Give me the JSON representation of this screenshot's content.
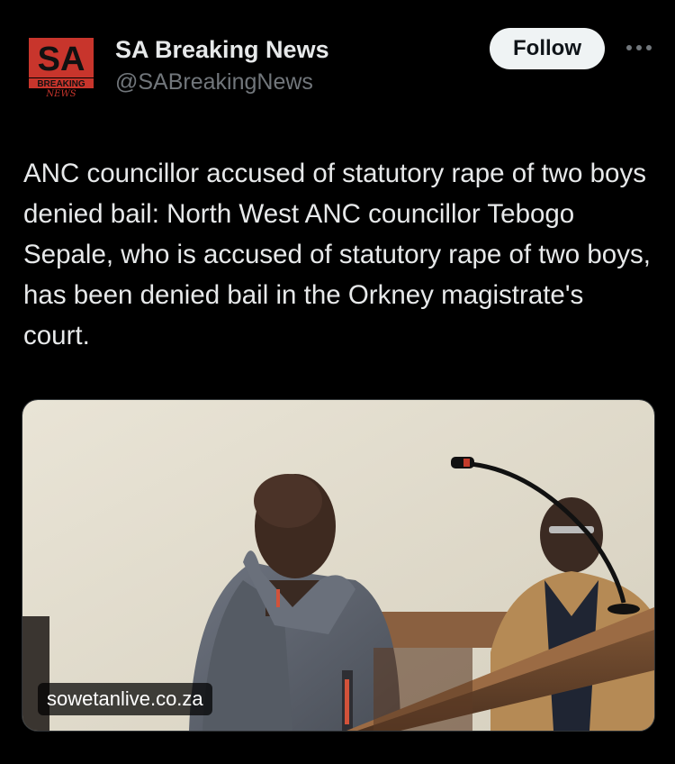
{
  "account": {
    "name": "SA Breaking News",
    "handle": "@SABreakingNews",
    "avatar_logo": {
      "main": "SA",
      "sub": "BREAKING",
      "script": "NEWS"
    }
  },
  "actions": {
    "follow_label": "Follow",
    "more_icon": "more-icon"
  },
  "tweet": {
    "text": "ANC councillor accused of statutory rape of two boys denied bail: North West ANC councillor Tebogo Sepale, who is accused of statutory rape of two boys, has been denied bail in the Orkney magistrate's court."
  },
  "media": {
    "source": "sowetanlive.co.za"
  },
  "colors": {
    "background": "#000000",
    "text": "#e7e9ea",
    "secondary_text": "#71767b",
    "follow_bg": "#eff3f4",
    "logo_red": "#c8352c"
  }
}
